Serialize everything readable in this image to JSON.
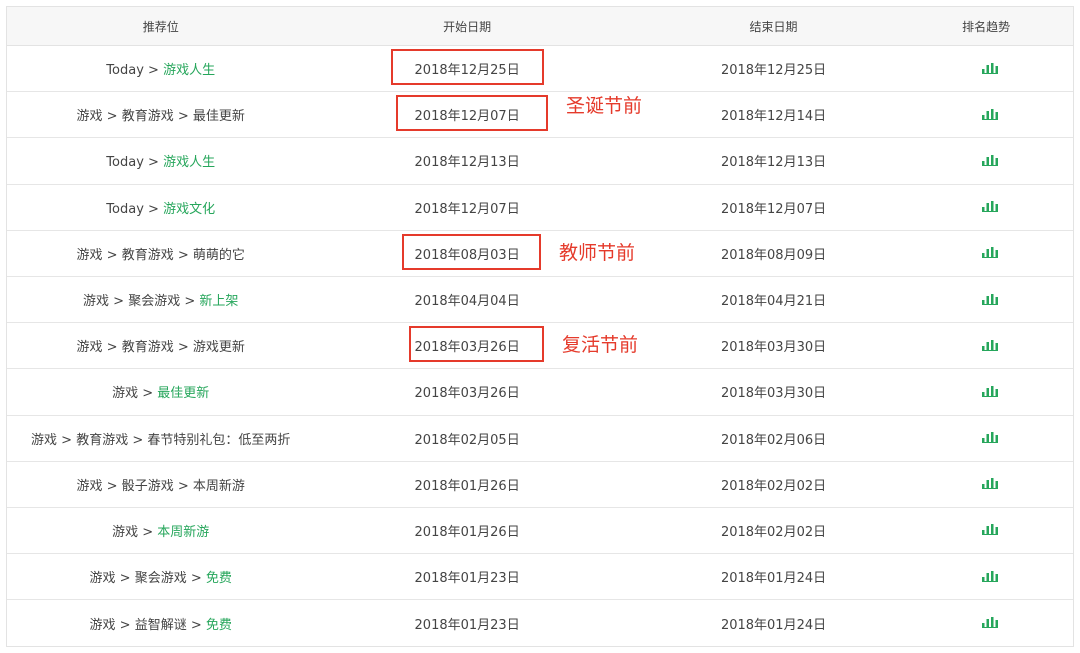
{
  "headers": {
    "position": "推荐位",
    "start_date": "开始日期",
    "end_date": "结束日期",
    "trend": "排名趋势"
  },
  "rows": [
    {
      "path": [
        {
          "t": "Today",
          "g": false
        },
        {
          "t": " > ",
          "g": false
        },
        {
          "t": "游戏人生",
          "g": true
        }
      ],
      "start": "2018年12月25日",
      "end": "2018年12月25日"
    },
    {
      "path": [
        {
          "t": "游戏 > 教育游戏 > 最佳更新",
          "g": false
        }
      ],
      "start": "2018年12月07日",
      "end": "2018年12月14日"
    },
    {
      "path": [
        {
          "t": "Today",
          "g": false
        },
        {
          "t": " > ",
          "g": false
        },
        {
          "t": "游戏人生",
          "g": true
        }
      ],
      "start": "2018年12月13日",
      "end": "2018年12月13日"
    },
    {
      "path": [
        {
          "t": "Today",
          "g": false
        },
        {
          "t": " > ",
          "g": false
        },
        {
          "t": "游戏文化",
          "g": true
        }
      ],
      "start": "2018年12月07日",
      "end": "2018年12月07日"
    },
    {
      "path": [
        {
          "t": "游戏 > 教育游戏 > 萌萌的它",
          "g": false
        }
      ],
      "start": "2018年08月03日",
      "end": "2018年08月09日"
    },
    {
      "path": [
        {
          "t": "游戏 > 聚会游戏 > ",
          "g": false
        },
        {
          "t": "新上架",
          "g": true
        }
      ],
      "start": "2018年04月04日",
      "end": "2018年04月21日"
    },
    {
      "path": [
        {
          "t": "游戏 > 教育游戏 > 游戏更新",
          "g": false
        }
      ],
      "start": "2018年03月26日",
      "end": "2018年03月30日"
    },
    {
      "path": [
        {
          "t": "游戏 > ",
          "g": false
        },
        {
          "t": "最佳更新",
          "g": true
        }
      ],
      "start": "2018年03月26日",
      "end": "2018年03月30日"
    },
    {
      "path": [
        {
          "t": "游戏 > 教育游戏 > 春节特别礼包：低至两折",
          "g": false
        }
      ],
      "start": "2018年02月05日",
      "end": "2018年02月06日"
    },
    {
      "path": [
        {
          "t": "游戏 > 骰子游戏 > 本周新游",
          "g": false
        }
      ],
      "start": "2018年01月26日",
      "end": "2018年02月02日"
    },
    {
      "path": [
        {
          "t": "游戏 > ",
          "g": false
        },
        {
          "t": "本周新游",
          "g": true
        }
      ],
      "start": "2018年01月26日",
      "end": "2018年02月02日"
    },
    {
      "path": [
        {
          "t": "游戏 > 聚会游戏 > ",
          "g": false
        },
        {
          "t": "免费",
          "g": true
        }
      ],
      "start": "2018年01月23日",
      "end": "2018年01月24日"
    },
    {
      "path": [
        {
          "t": "游戏 > 益智解谜 > ",
          "g": false
        },
        {
          "t": "免费",
          "g": true
        }
      ],
      "start": "2018年01月23日",
      "end": "2018年01月24日"
    }
  ],
  "annotations": [
    {
      "row": 0,
      "label": ""
    },
    {
      "row": 1,
      "label": "圣诞节前"
    },
    {
      "row": 4,
      "label": "教师节前"
    },
    {
      "row": 6,
      "label": "复活节前"
    }
  ],
  "icons": {
    "trend": "bar-chart-icon"
  },
  "colors": {
    "accent_green": "#26a65b",
    "annotation_red": "#e53a2b"
  }
}
